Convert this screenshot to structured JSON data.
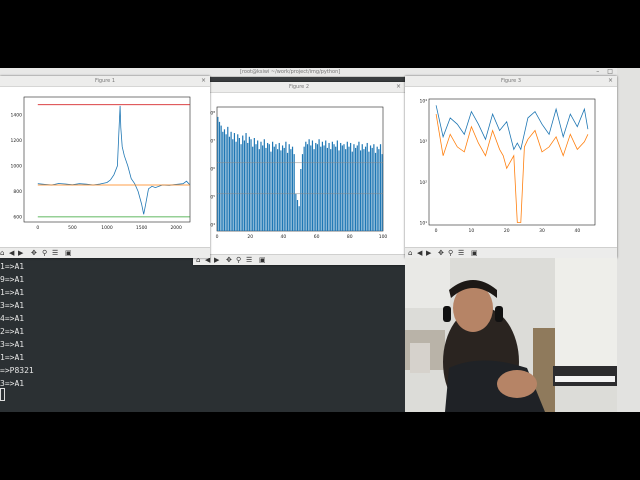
{
  "topbar": {
    "title": "[root@ksiwi ~/work/project/img/python]"
  },
  "figures": {
    "fig1": {
      "window_title": "Figure 1",
      "close": "×",
      "chart_data": {
        "type": "line",
        "xlim": [
          -200,
          2200
        ],
        "ylim": [
          560,
          1540
        ],
        "xticks": [
          "0",
          "500",
          "1000",
          "1500",
          "2000"
        ],
        "yticks": [
          "600",
          "800",
          "1000",
          "1200",
          "1400"
        ],
        "series": [
          {
            "color": "#1f77b4",
            "x": [
              0,
              100,
              200,
              300,
              400,
              500,
              600,
              700,
              800,
              900,
              1000,
              1050,
              1100,
              1150,
              1170,
              1190,
              1200,
              1220,
              1250,
              1300,
              1350,
              1400,
              1450,
              1500,
              1530,
              1560,
              1600,
              1650,
              1700,
              1800,
              1900,
              2000,
              2100,
              2150,
              2200
            ],
            "y": [
              860,
              855,
              850,
              862,
              858,
              852,
              860,
              856,
              850,
              858,
              870,
              890,
              930,
              1000,
              1250,
              1470,
              1300,
              1150,
              1080,
              1000,
              900,
              860,
              800,
              700,
              620,
              700,
              820,
              840,
              830,
              850,
              848,
              855,
              860,
              880,
              850
            ]
          },
          {
            "color": "#ff7f0e",
            "x": [
              0,
              2200
            ],
            "y": [
              850,
              850
            ]
          },
          {
            "color": "#d62728",
            "x": [
              0,
              2200
            ],
            "y": [
              1480,
              1480
            ]
          },
          {
            "color": "#2ca02c",
            "x": [
              0,
              2200
            ],
            "y": [
              600,
              600
            ]
          }
        ]
      }
    },
    "fig2": {
      "window_title": "Figure 2",
      "close": "×",
      "chart_data": {
        "type": "bar",
        "xlim": [
          0,
          100
        ],
        "xticks": [
          "0",
          "20",
          "40",
          "60",
          "80",
          "100"
        ],
        "yticks": [
          "10⁸",
          "10⁷",
          "10⁶",
          "10⁵",
          "10⁴"
        ],
        "series": [
          {
            "name": "",
            "color": "#1f77b4",
            "values": [
              0.92,
              0.88,
              0.85,
              0.8,
              0.82,
              0.78,
              0.84,
              0.76,
              0.8,
              0.74,
              0.79,
              0.72,
              0.78,
              0.75,
              0.7,
              0.77,
              0.73,
              0.79,
              0.71,
              0.76,
              0.74,
              0.68,
              0.75,
              0.7,
              0.73,
              0.66,
              0.72,
              0.69,
              0.74,
              0.67,
              0.71,
              0.7,
              0.64,
              0.72,
              0.68,
              0.7,
              0.66,
              0.71,
              0.65,
              0.69,
              0.67,
              0.72,
              0.63,
              0.7,
              0.66,
              0.68,
              0.62,
              0.3,
              0.25,
              0.2,
              0.5,
              0.62,
              0.68,
              0.72,
              0.7,
              0.74,
              0.69,
              0.73,
              0.66,
              0.71,
              0.7,
              0.74,
              0.68,
              0.72,
              0.69,
              0.73,
              0.67,
              0.71,
              0.66,
              0.72,
              0.7,
              0.68,
              0.73,
              0.65,
              0.71,
              0.69,
              0.7,
              0.66,
              0.72,
              0.68,
              0.71,
              0.64,
              0.7,
              0.67,
              0.69,
              0.72,
              0.65,
              0.7,
              0.66,
              0.68,
              0.71,
              0.64,
              0.69,
              0.67,
              0.7,
              0.63,
              0.68,
              0.66,
              0.7,
              0.62
            ]
          }
        ],
        "hlines": [
          0.55,
          0.3
        ]
      }
    },
    "fig3": {
      "window_title": "Figure 3",
      "close": "×",
      "chart_data": {
        "type": "line",
        "xlim": [
          -2,
          45
        ],
        "xticks": [
          "0",
          "10",
          "20",
          "30",
          "40"
        ],
        "yticks": [
          "10⁴",
          "10³",
          "10²",
          "10¹"
        ],
        "series": [
          {
            "color": "#1f77b4",
            "x": [
              0,
              2,
              4,
              6,
              8,
              10,
              12,
              14,
              16,
              18,
              20,
              22,
              23,
              24,
              26,
              28,
              30,
              32,
              34,
              36,
              38,
              40,
              42,
              43
            ],
            "y": [
              0.95,
              0.7,
              0.85,
              0.8,
              0.72,
              0.9,
              0.8,
              0.68,
              0.88,
              0.75,
              0.82,
              0.6,
              0.65,
              0.6,
              0.85,
              0.9,
              0.8,
              0.72,
              0.92,
              0.7,
              0.88,
              0.78,
              0.92,
              0.76
            ]
          },
          {
            "color": "#ff7f0e",
            "x": [
              0,
              2,
              4,
              6,
              8,
              10,
              12,
              14,
              16,
              18,
              19,
              20,
              22,
              23,
              24,
              25,
              26,
              28,
              30,
              32,
              34,
              36,
              38,
              40,
              42,
              43
            ],
            "y": [
              0.88,
              0.55,
              0.72,
              0.62,
              0.58,
              0.78,
              0.65,
              0.55,
              0.75,
              0.6,
              0.55,
              0.45,
              0.55,
              0.02,
              0.02,
              0.62,
              0.68,
              0.75,
              0.58,
              0.62,
              0.7,
              0.55,
              0.72,
              0.6,
              0.66,
              0.72
            ]
          }
        ]
      }
    }
  },
  "toolbar_icons": [
    "home-icon",
    "back-arrow-icon",
    "forward-arrow-icon",
    "pan-icon",
    "zoom-icon",
    "subplots-icon",
    "save-icon"
  ],
  "terminal": {
    "lines": [
      "1=>A1",
      "9=>A1",
      "1=>A1",
      "3=>A1",
      "4=>A1",
      "2=>A1",
      "3=>A1",
      "1=>A1",
      "=>P8321",
      "3=>A1"
    ]
  }
}
